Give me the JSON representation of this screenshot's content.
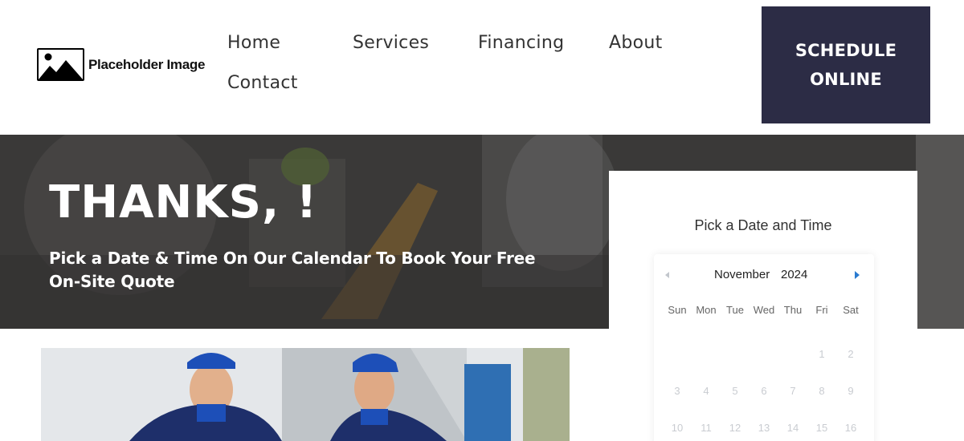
{
  "logo": {
    "text": "Placeholder Image"
  },
  "nav": {
    "home": "Home",
    "services": "Services",
    "financing": "Financing",
    "about": "About",
    "contact": "Contact"
  },
  "cta": {
    "line1": "SCHEDULE",
    "line2": "ONLINE"
  },
  "hero": {
    "title": "THANKS, !",
    "subtitle": "Pick a Date & Time On Our Calendar To Book Your Free On-Site Quote"
  },
  "booking": {
    "title": "Pick a Date and Time",
    "month": "November",
    "year": "2024",
    "weekdays": [
      "Sun",
      "Mon",
      "Tue",
      "Wed",
      "Thu",
      "Fri",
      "Sat"
    ],
    "week1": [
      "1",
      "2"
    ],
    "week2": [
      "3",
      "4",
      "5",
      "6",
      "7",
      "8",
      "9"
    ],
    "week3": [
      "10",
      "11",
      "12",
      "13",
      "14",
      "15",
      "16"
    ]
  },
  "colors": {
    "cta_bg": "#2c2c45",
    "nav_text": "#333333",
    "calendar_next_arrow": "#2a7bd0",
    "calendar_disabled_day": "#c9ccd1"
  },
  "icons": {
    "logo": "image-placeholder-icon",
    "prev": "chevron-left-icon",
    "next": "chevron-right-icon"
  }
}
